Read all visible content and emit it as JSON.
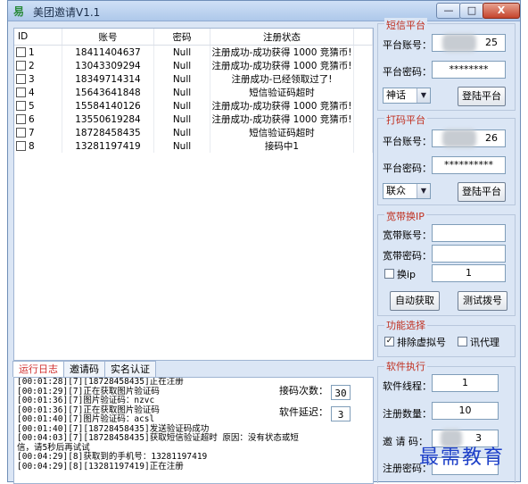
{
  "window": {
    "title": "美团邀请V1.1",
    "app_icon": "易"
  },
  "grid": {
    "headers": [
      "ID",
      "账号",
      "密码",
      "注册状态"
    ],
    "rows": [
      {
        "id": "1",
        "account": "18411404637",
        "password": "Null",
        "status": "注册成功-成功获得 1000 竞猜币!"
      },
      {
        "id": "2",
        "account": "13043309294",
        "password": "Null",
        "status": "注册成功-成功获得 1000 竞猜币!"
      },
      {
        "id": "3",
        "account": "18349714314",
        "password": "Null",
        "status": "注册成功-已经领取过了!"
      },
      {
        "id": "4",
        "account": "15643641848",
        "password": "Null",
        "status": "短信验证码超时"
      },
      {
        "id": "5",
        "account": "15584140126",
        "password": "Null",
        "status": "注册成功-成功获得 1000 竞猜币!"
      },
      {
        "id": "6",
        "account": "13550619284",
        "password": "Null",
        "status": "注册成功-成功获得 1000 竞猜币!"
      },
      {
        "id": "7",
        "account": "18728458435",
        "password": "Null",
        "status": "短信验证码超时"
      },
      {
        "id": "8",
        "account": "13281197419",
        "password": "Null",
        "status": "接码中1"
      }
    ]
  },
  "tabs": [
    "运行日志",
    "邀请码",
    "实名认证"
  ],
  "log": {
    "lines": [
      "[00:01:28][7][18728458435]正在注册",
      "[00:01:29][7]正在获取图片验证码",
      "[00:01:36][7]图片验证码：nzvc",
      "[00:01:36][7]正在获取图片验证码",
      "[00:01:40][7]图片验证码：acsl",
      "[00:01:40][7][18728458435]发送验证码成功",
      "[00:04:03][7][18728458435]获取短信验证超时    原因：没有状态或短",
      "信，请5秒后再试试",
      "[00:04:29][8]获取到的手机号：13281197419",
      "[00:04:29][8][13281197419]正在注册"
    ],
    "retry_label": "接码次数：",
    "retry_value": "30",
    "delay_label": "软件延迟：",
    "delay_value": "3"
  },
  "sms_platform": {
    "title": "短信平台",
    "account_label": "平台账号：",
    "account_suffix": "25",
    "password_label": "平台密码：",
    "password_mask": "********",
    "platform_select": "神话",
    "login_button": "登陆平台"
  },
  "captcha_platform": {
    "title": "打码平台",
    "account_label": "平台账号：",
    "account_suffix": "26",
    "password_label": "平台密码：",
    "password_mask": "**********",
    "platform_select": "联众",
    "login_button": "登陆平台"
  },
  "broadband": {
    "title": "宽带换IP",
    "account_label": "宽带账号：",
    "password_label": "宽带密码：",
    "switch_ip_label": "换ip",
    "switch_ip_value": "1",
    "auto_get_button": "自动获取",
    "test_dial_button": "测试拨号"
  },
  "features": {
    "title": "功能选择",
    "exclude_virtual_label": "排除虚拟号",
    "exclude_virtual_checked": true,
    "proxy_label": "讯代理",
    "proxy_checked": false
  },
  "execution": {
    "title": "软件执行",
    "threads_label": "软件线程：",
    "threads_value": "1",
    "register_count_label": "注册数量：",
    "register_count_value": "10",
    "invite_code_label": "邀 请 码：",
    "invite_code_value": "3",
    "register_pwd_label": "注册密码："
  },
  "watermark": "最需教育"
}
